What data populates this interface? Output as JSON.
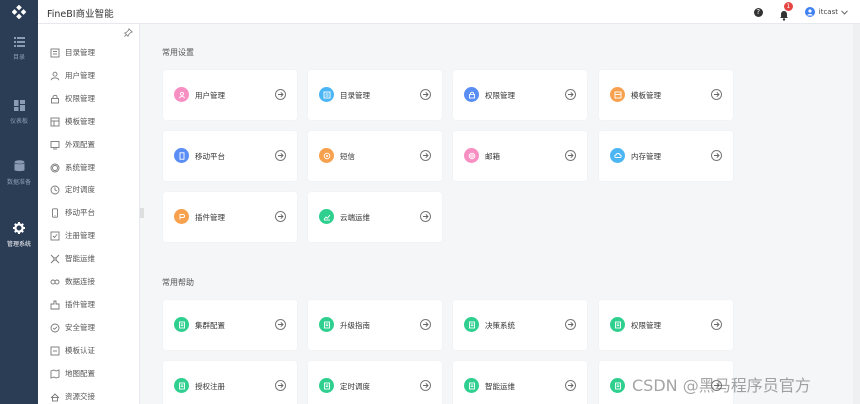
{
  "header": {
    "app_title": "FineBI商业智能",
    "notification_count": "1",
    "username": "itcast"
  },
  "dark_nav": [
    {
      "label": "目录",
      "icon": "list-icon"
    },
    {
      "label": "仪表板",
      "icon": "dashboard-icon"
    },
    {
      "label": "数据准备",
      "icon": "database-icon"
    },
    {
      "label": "管理系统",
      "icon": "gear-icon",
      "active": true
    }
  ],
  "sub_nav": [
    {
      "label": "目录管理",
      "icon": "directory-icon"
    },
    {
      "label": "用户管理",
      "icon": "user-icon"
    },
    {
      "label": "权限管理",
      "icon": "lock-icon"
    },
    {
      "label": "模板管理",
      "icon": "template-icon"
    },
    {
      "label": "外观配置",
      "icon": "appearance-icon"
    },
    {
      "label": "系统管理",
      "icon": "system-icon"
    },
    {
      "label": "定时调度",
      "icon": "clock-icon"
    },
    {
      "label": "移动平台",
      "icon": "mobile-icon"
    },
    {
      "label": "注册管理",
      "icon": "register-icon"
    },
    {
      "label": "智能运维",
      "icon": "ops-icon"
    },
    {
      "label": "数据连接",
      "icon": "data-connection-icon"
    },
    {
      "label": "插件管理",
      "icon": "plugin-icon"
    },
    {
      "label": "安全管理",
      "icon": "security-icon"
    },
    {
      "label": "模板认证",
      "icon": "template-auth-icon"
    },
    {
      "label": "地图配置",
      "icon": "map-icon"
    },
    {
      "label": "资源交接",
      "icon": "resource-icon"
    }
  ],
  "common_settings": {
    "title": "常用设置",
    "cards": [
      {
        "label": "用户管理",
        "color": "#f78fc3",
        "icon": "user-icon"
      },
      {
        "label": "目录管理",
        "color": "#4cb6f5",
        "icon": "directory-icon"
      },
      {
        "label": "权限管理",
        "color": "#5a8ef4",
        "icon": "lock-icon"
      },
      {
        "label": "模板管理",
        "color": "#f7a14f",
        "icon": "template-icon"
      },
      {
        "label": "移动平台",
        "color": "#5a8ef4",
        "icon": "mobile-icon"
      },
      {
        "label": "短信",
        "color": "#f7a14f",
        "icon": "sms-icon"
      },
      {
        "label": "邮箱",
        "color": "#f78fc3",
        "icon": "mail-icon"
      },
      {
        "label": "内存管理",
        "color": "#4cb6f5",
        "icon": "memory-icon"
      },
      {
        "label": "插件管理",
        "color": "#f7a14f",
        "icon": "plugin-icon"
      },
      {
        "label": "云端运维",
        "color": "#2fcf8f",
        "icon": "cloud-ops-icon"
      }
    ]
  },
  "common_help": {
    "title": "常用帮助",
    "cards": [
      {
        "label": "集群配置",
        "color": "#2fcf8f",
        "icon": "doc-icon"
      },
      {
        "label": "升级指南",
        "color": "#2fcf8f",
        "icon": "doc-icon"
      },
      {
        "label": "决策系统",
        "color": "#2fcf8f",
        "icon": "doc-icon"
      },
      {
        "label": "权限管理",
        "color": "#2fcf8f",
        "icon": "doc-icon"
      },
      {
        "label": "授权注册",
        "color": "#2fcf8f",
        "icon": "doc-icon"
      },
      {
        "label": "定时调度",
        "color": "#2fcf8f",
        "icon": "doc-icon"
      },
      {
        "label": "智能运维",
        "color": "#2fcf8f",
        "icon": "doc-icon"
      },
      {
        "label": "",
        "color": "#2fcf8f",
        "icon": "doc-icon"
      }
    ]
  },
  "watermark": "CSDN @黑马程序员官方",
  "colors": {
    "nav_bg": "#2b3c55",
    "accent": "#3f80f2"
  }
}
